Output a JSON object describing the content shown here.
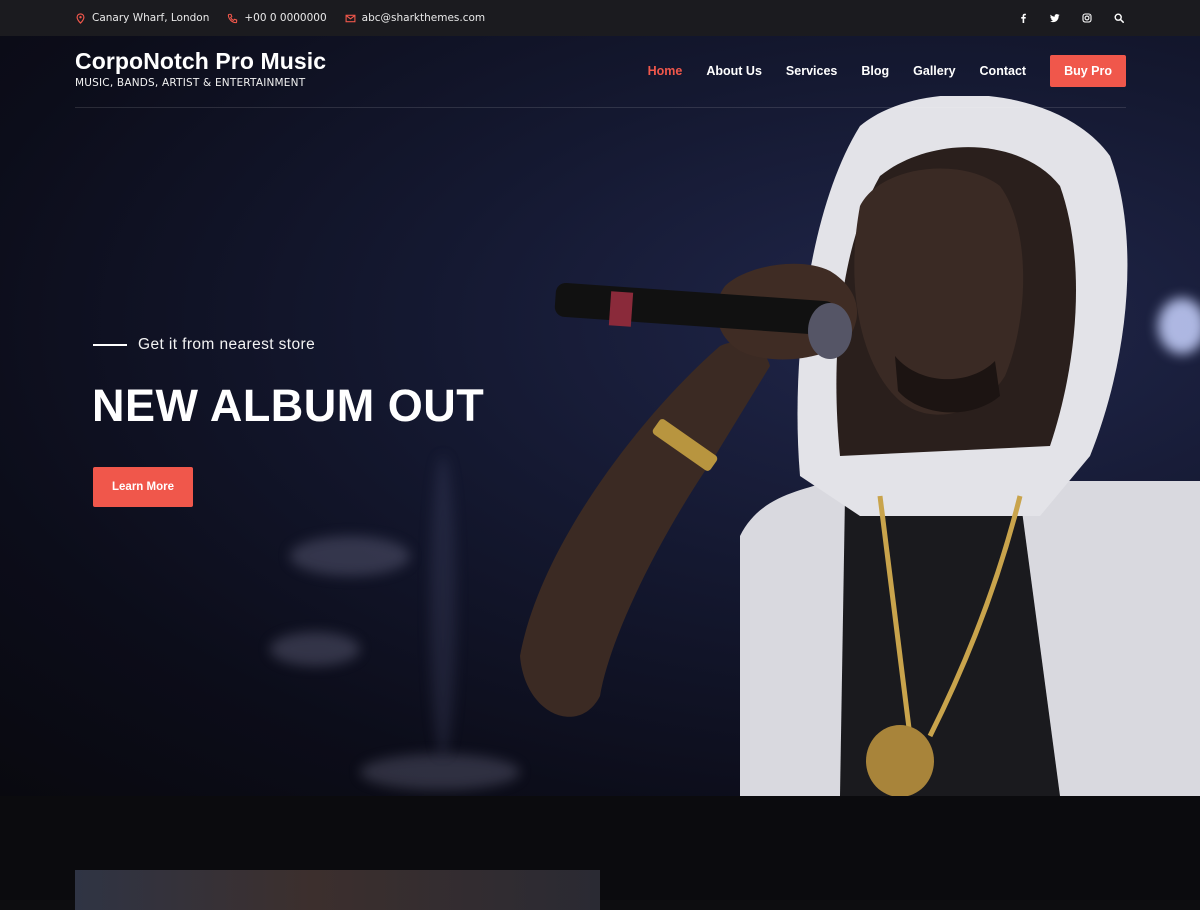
{
  "topbar": {
    "address": "Canary Wharf, London",
    "phone": "+00 0 0000000",
    "email": "abc@sharkthemes.com",
    "social": [
      "facebook-icon",
      "twitter-icon",
      "instagram-icon",
      "search-icon"
    ]
  },
  "brand": {
    "title": "CorpoNotch Pro Music",
    "tagline": "MUSIC, BANDS, ARTIST & ENTERTAINMENT"
  },
  "nav": {
    "items": [
      {
        "label": "Home",
        "active": true
      },
      {
        "label": "About Us",
        "active": false
      },
      {
        "label": "Services",
        "active": false
      },
      {
        "label": "Blog",
        "active": false
      },
      {
        "label": "Gallery",
        "active": false
      },
      {
        "label": "Contact",
        "active": false
      }
    ],
    "buy_label": "Buy Pro"
  },
  "hero": {
    "eyebrow": "Get it from nearest store",
    "headline": "NEW ALBUM OUT",
    "cta_label": "Learn More"
  },
  "colors": {
    "accent": "#f0574b",
    "topbar_bg": "#1b1b1f",
    "page_bg": "#0b0b0e"
  }
}
